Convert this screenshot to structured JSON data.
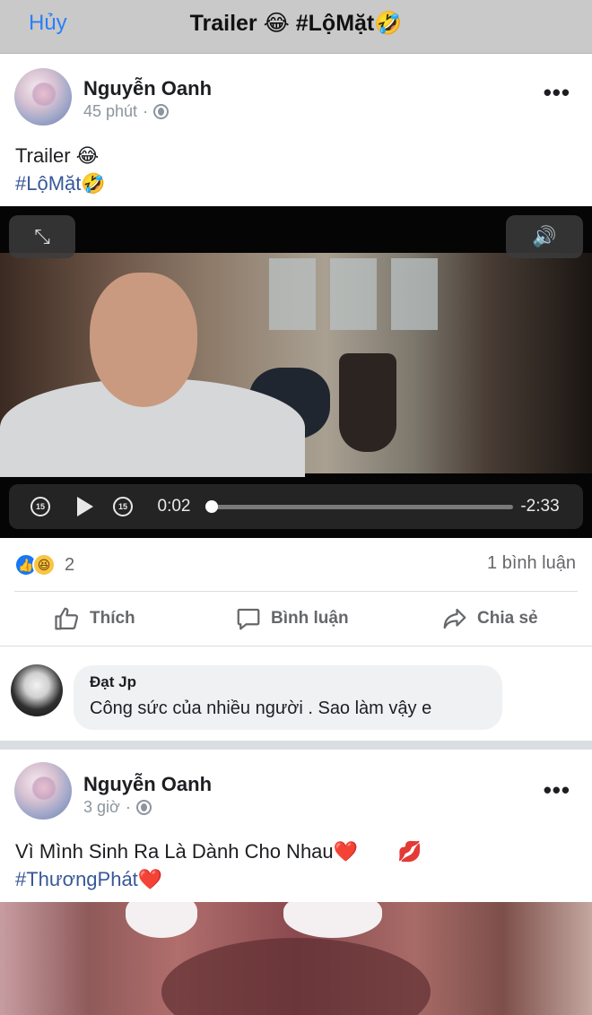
{
  "navbar": {
    "cancel_label": "Hủy",
    "title": "Trailer 😂 #LộMặt🤣"
  },
  "post1": {
    "author": "Nguyễn Oanh",
    "time": "45 phút",
    "privacy_icon": "globe-icon",
    "more_label": "•••",
    "text_line1": "Trailer 😂",
    "hashtag": "#LộMặt🤣",
    "video": {
      "current_time": "0:02",
      "remaining_time": "-2:33",
      "progress_fraction": 0.013,
      "expand_icon": "⤡",
      "volume_icon": "🔊",
      "skip_back_label": "15",
      "skip_forward_label": "15"
    },
    "reactions": {
      "like_icon": "👍",
      "haha_icon": "😆",
      "count": "2"
    },
    "comment_count": "1 bình luận",
    "actions": {
      "like": "Thích",
      "comment": "Bình luận",
      "share": "Chia sẻ"
    },
    "comment": {
      "author": "Đạt Jp",
      "text": "Công sức của nhiều người . Sao làm vậy e"
    }
  },
  "post2": {
    "author": "Nguyễn Oanh",
    "time": "3 giờ",
    "privacy_icon": "globe-icon",
    "more_label": "•••",
    "text_line1": "Vì Mình Sinh Ra Là Dành Cho Nhau❤️",
    "kiss_icon": "💋",
    "hashtag": "#ThươngPhát❤️"
  },
  "colors": {
    "link_blue": "#2d7ef7",
    "hashtag": "#385898",
    "like_blue": "#1877f2",
    "navbar_bg": "#c9c9c9"
  }
}
